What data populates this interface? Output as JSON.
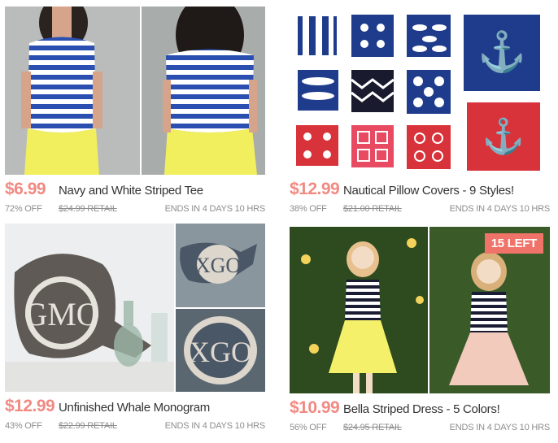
{
  "deals": [
    {
      "price": "$6.99",
      "title": "Navy and White Striped Tee",
      "percent_off": "72% OFF",
      "retail": "$24.99 RETAIL",
      "ends": "ENDS IN 4 DAYS 10 HRS",
      "image": "striped-tee-photo"
    },
    {
      "price": "$12.99",
      "title": "Nautical Pillow Covers - 9 Styles!",
      "percent_off": "38% OFF",
      "retail": "$21.00 RETAIL",
      "ends": "ENDS IN 4 DAYS 10 HRS",
      "image": "pillow-covers-photo"
    },
    {
      "price": "$12.99",
      "title": "Unfinished Whale Monogram",
      "percent_off": "43% OFF",
      "retail": "$22.99 RETAIL",
      "ends": "ENDS IN 4 DAYS 10 HRS",
      "image": "whale-monogram-photo"
    },
    {
      "price": "$10.99",
      "title": "Bella Striped Dress - 5 Colors!",
      "percent_off": "56% OFF",
      "retail": "$24.95 RETAIL",
      "ends": "ENDS IN 4 DAYS 10 HRS",
      "badge": "15 LEFT",
      "image": "striped-dress-photo"
    }
  ],
  "colors": {
    "price": "#f08a83",
    "badge": "#f0736a",
    "navy": "#1f3c8c",
    "red": "#d8323a",
    "yellow": "#f4f06a"
  }
}
